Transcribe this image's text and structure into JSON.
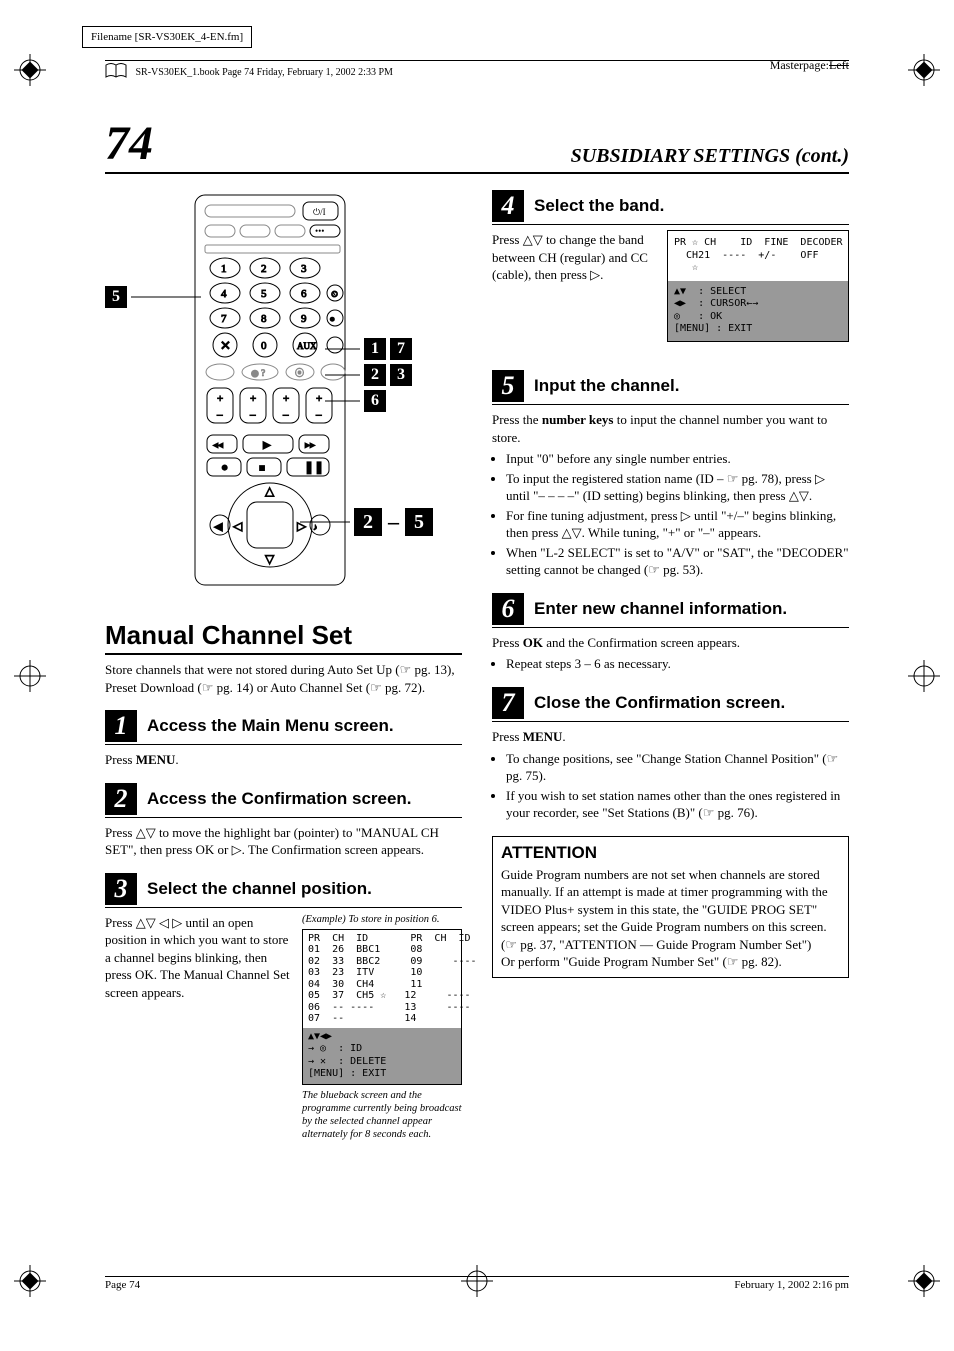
{
  "meta": {
    "filename_label": "Filename [SR-VS30EK_4-EN.fm]",
    "bookline": "SR-VS30EK_1.book  Page 74  Friday, February 1, 2002  2:33 PM",
    "masterpage_label": "Masterpage:",
    "masterpage_value": "Left",
    "page_number": "74",
    "section_title": "SUBSIDIARY SETTINGS (cont.)",
    "footer_left": "Page 74",
    "footer_right": "February 1, 2002  2:16 pm"
  },
  "remote_callouts": {
    "left": "5",
    "r1a": "1",
    "r1b": "7",
    "r2a": "2",
    "r2b": "3",
    "r3": "6",
    "r4a": "2",
    "r4sep": "–",
    "r4b": "5"
  },
  "left": {
    "topic": "Manual Channel Set",
    "intro": "Store channels that were not stored during Auto Set Up (☞ pg. 13), Preset Download (☞ pg. 14) or Auto Channel Set (☞ pg. 72).",
    "step1": {
      "num": "1",
      "title": "Access the Main Menu screen.",
      "body_pre": "Press ",
      "body_key": "MENU",
      "body_post": "."
    },
    "step2": {
      "num": "2",
      "title": "Access the Confirmation screen.",
      "body": "Press △▽ to move the highlight bar (pointer) to \"MANUAL CH SET\", then press OK or ▷. The Confirmation screen appears."
    },
    "step3": {
      "num": "3",
      "title": "Select the channel position.",
      "body": "Press △▽ ◁ ▷ until an open position in which you want to store a channel begins blinking, then press OK. The Manual Channel Set screen appears.",
      "example_label": "(Example) To store in position 6.",
      "screen_top": "PR  CH  ID       PR  CH  ID\n01  26  BBC1     08\n02  33  BBC2     09     ----\n03  23  ITV      10\n04  30  CH4      11\n05  37  CH5 ☆   12     ----\n06  -- ----     13     ----\n07  --          14",
      "screen_bot": "▲▼◀▶\n→ ◎  : ID\n→ ✕  : DELETE\n[MENU] : EXIT",
      "caption": "The blueback screen and the programme currently being broadcast by the selected channel appear alternately for 8 seconds each."
    }
  },
  "right": {
    "step4": {
      "num": "4",
      "title": "Select the band.",
      "body": "Press △▽ to change the band between CH (regular) and CC (cable), then press ▷.",
      "screen_top": "PR ☆ CH    ID  FINE  DECODER\n  CH21  ----  +/-    OFF\n   ☆",
      "screen_bot": "▲▼  : SELECT\n◀▶  : CURSOR←→\n◎   : OK\n[MENU] : EXIT"
    },
    "step5": {
      "num": "5",
      "title": "Input the channel.",
      "body_lead_a": "Press the ",
      "body_lead_key": "number keys",
      "body_lead_b": " to input the channel number you want to store.",
      "bullets": [
        "Input \"0\" before any single number entries.",
        "To input the registered station name (ID – ☞ pg. 78), press ▷ until \"– – – –\" (ID setting) begins blinking, then press △▽.",
        "For fine tuning adjustment, press ▷ until \"+/–\" begins blinking, then press △▽. While tuning, \"+\" or \"–\" appears.",
        "When \"L-2 SELECT\" is set to \"A/V\" or \"SAT\", the \"DECODER\" setting cannot be changed (☞ pg. 53)."
      ]
    },
    "step6": {
      "num": "6",
      "title": "Enter new channel information.",
      "body_a": "Press ",
      "body_key": "OK",
      "body_b": " and the Confirmation screen appears.",
      "bullet": "Repeat steps 3 – 6 as necessary."
    },
    "step7": {
      "num": "7",
      "title": "Close the Confirmation screen.",
      "body_a": "Press ",
      "body_key": "MENU",
      "body_b": ".",
      "bullets": [
        "To change positions, see \"Change Station Channel Position\" (☞ pg. 75).",
        "If you wish to set station names other than the ones registered in your recorder, see \"Set Stations (B)\" (☞ pg. 76)."
      ]
    },
    "attention": {
      "title": "ATTENTION",
      "body": "Guide Program numbers are not set when channels are stored manually. If an attempt is made at timer programming with the VIDEO Plus+ system in this state, the \"GUIDE PROG SET\" screen appears; set the Guide Program numbers on this screen. (☞ pg. 37, \"ATTENTION — Guide Program Number Set\")",
      "body2": "Or perform \"Guide Program Number Set\" (☞ pg. 82)."
    }
  }
}
